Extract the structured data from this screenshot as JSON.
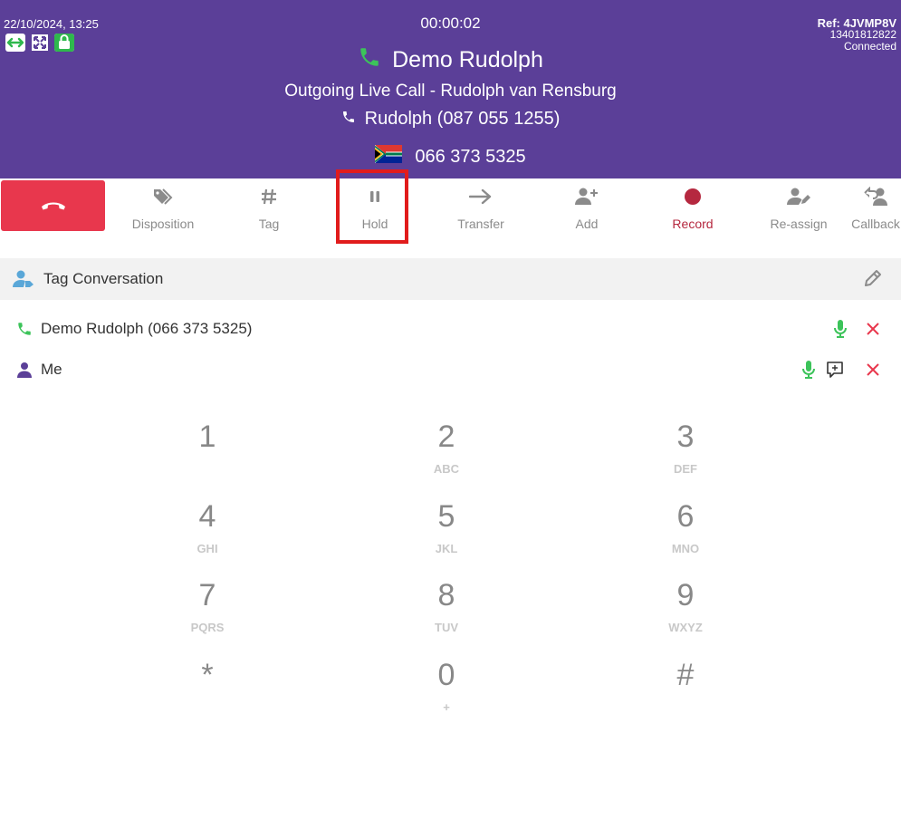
{
  "header": {
    "datetime": "22/10/2024, 13:25",
    "timer": "00:00:02",
    "ref": "Ref: 4JVMP8V",
    "ref_id": "13401812822",
    "status": "Connected",
    "contact_name": "Demo Rudolph",
    "call_description": "Outgoing Live Call - Rudolph van Rensburg",
    "line": "Rudolph (087 055 1255)",
    "dialed_number": "066 373 5325",
    "flag_country": "South Africa"
  },
  "toolbar": {
    "buttons": [
      {
        "label": "Disposition",
        "icon": "tag-icon"
      },
      {
        "label": "Tag",
        "icon": "hash-icon"
      },
      {
        "label": "Hold",
        "icon": "pause-icon"
      },
      {
        "label": "Transfer",
        "icon": "arrow-right-icon"
      },
      {
        "label": "Add",
        "icon": "user-plus-icon"
      },
      {
        "label": "Record",
        "icon": "record-dot-icon"
      },
      {
        "label": "Re-assign",
        "icon": "user-edit-icon"
      },
      {
        "label": "Callback",
        "icon": "callback-icon"
      }
    ]
  },
  "tag_bar": {
    "label": "Tag Conversation"
  },
  "participants": [
    {
      "name": "Demo Rudolph (066 373 5325)",
      "icon": "phone-icon"
    },
    {
      "name": "Me",
      "icon": "user-icon"
    }
  ],
  "dialpad": {
    "keys": [
      {
        "digit": "1",
        "letters": ""
      },
      {
        "digit": "2",
        "letters": "ABC"
      },
      {
        "digit": "3",
        "letters": "DEF"
      },
      {
        "digit": "4",
        "letters": "GHI"
      },
      {
        "digit": "5",
        "letters": "JKL"
      },
      {
        "digit": "6",
        "letters": "MNO"
      },
      {
        "digit": "7",
        "letters": "PQRS"
      },
      {
        "digit": "8",
        "letters": "TUV"
      },
      {
        "digit": "9",
        "letters": "WXYZ"
      },
      {
        "digit": "*",
        "letters": ""
      },
      {
        "digit": "0",
        "letters": "+"
      },
      {
        "digit": "#",
        "letters": ""
      }
    ]
  },
  "colors": {
    "header_bg": "#5b3f98",
    "hangup": "#e8374d",
    "accent_green": "#3cc35a",
    "record_red": "#b5283f",
    "highlight": "#e11c1c"
  }
}
